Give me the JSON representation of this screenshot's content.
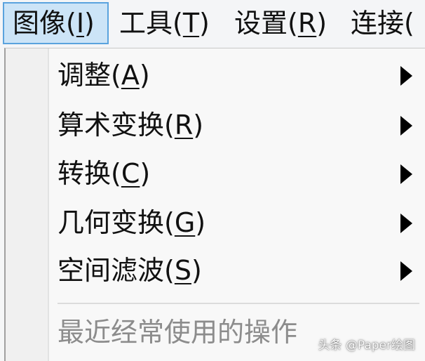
{
  "menubar": {
    "items": [
      {
        "label": "图像(",
        "mnemonic": "I",
        "suffix": ")"
      },
      {
        "label": "工具(",
        "mnemonic": "T",
        "suffix": ")"
      },
      {
        "label": "设置(",
        "mnemonic": "R",
        "suffix": ")"
      },
      {
        "label": "连接(",
        "mnemonic": "",
        "suffix": ""
      }
    ]
  },
  "dropdown": {
    "items": [
      {
        "label": "调整(",
        "mnemonic": "A",
        "suffix": ")",
        "has_submenu": true
      },
      {
        "label": "算术变换(",
        "mnemonic": "R",
        "suffix": ")",
        "has_submenu": true
      },
      {
        "label": "转换(",
        "mnemonic": "C",
        "suffix": ")",
        "has_submenu": true
      },
      {
        "label": "几何变换(",
        "mnemonic": "G",
        "suffix": ")",
        "has_submenu": true
      },
      {
        "label": "空间滤波(",
        "mnemonic": "S",
        "suffix": ")",
        "has_submenu": true
      }
    ],
    "disabled_item": "最近经常使用的操作"
  },
  "watermark": "头条 @Paper绘图",
  "colors": {
    "active_bg": "#cce4f7",
    "active_border": "#5aa3de",
    "disabled_text": "#8c8c8c"
  }
}
